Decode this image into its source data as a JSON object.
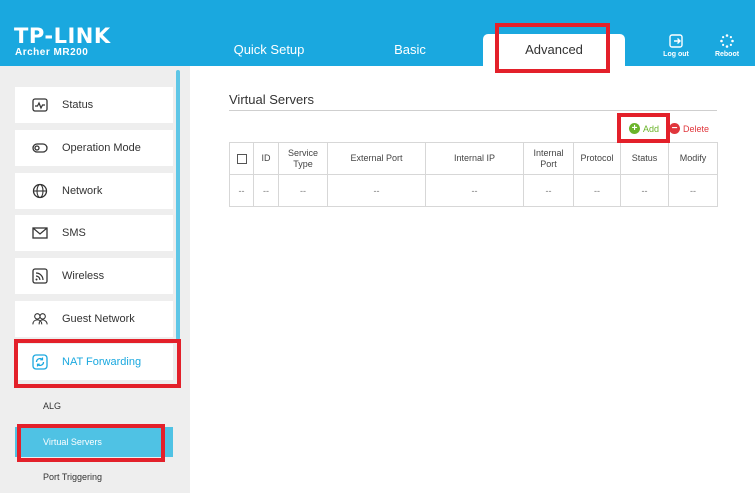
{
  "brand": {
    "logo": "TP-LINK",
    "model": "Archer MR200"
  },
  "nav_tabs": [
    {
      "label": "Quick Setup"
    },
    {
      "label": "Basic"
    },
    {
      "label": "Advanced"
    }
  ],
  "header_actions": {
    "logout": "Log out",
    "reboot": "Reboot"
  },
  "sidebar": {
    "items": [
      {
        "label": "Status",
        "icon": "status-pulse-icon"
      },
      {
        "label": "Operation Mode",
        "icon": "toggle-switch-icon"
      },
      {
        "label": "Network",
        "icon": "globe-icon"
      },
      {
        "label": "SMS",
        "icon": "envelope-icon"
      },
      {
        "label": "Wireless",
        "icon": "wifi-icon"
      },
      {
        "label": "Guest Network",
        "icon": "guest-users-icon"
      },
      {
        "label": "NAT Forwarding",
        "icon": "nat-refresh-icon"
      }
    ],
    "sub_items": [
      {
        "label": "ALG"
      },
      {
        "label": "Virtual Servers"
      },
      {
        "label": "Port Triggering"
      }
    ]
  },
  "content": {
    "title": "Virtual Servers",
    "add_label": "Add",
    "delete_label": "Delete",
    "table": {
      "headers": [
        "ID",
        "Service Type",
        "External Port",
        "Internal IP",
        "Internal Port",
        "Protocol",
        "Status",
        "Modify"
      ],
      "rows": [
        [
          "--",
          "--",
          "--",
          "--",
          "--",
          "--",
          "--",
          "--",
          "--"
        ]
      ]
    }
  },
  "colors": {
    "header_bg": "#1aa8df",
    "accent": "#1aa8df",
    "add_green": "#6ab42a",
    "delete_red": "#e0363c",
    "highlight_red": "#e3202a"
  }
}
